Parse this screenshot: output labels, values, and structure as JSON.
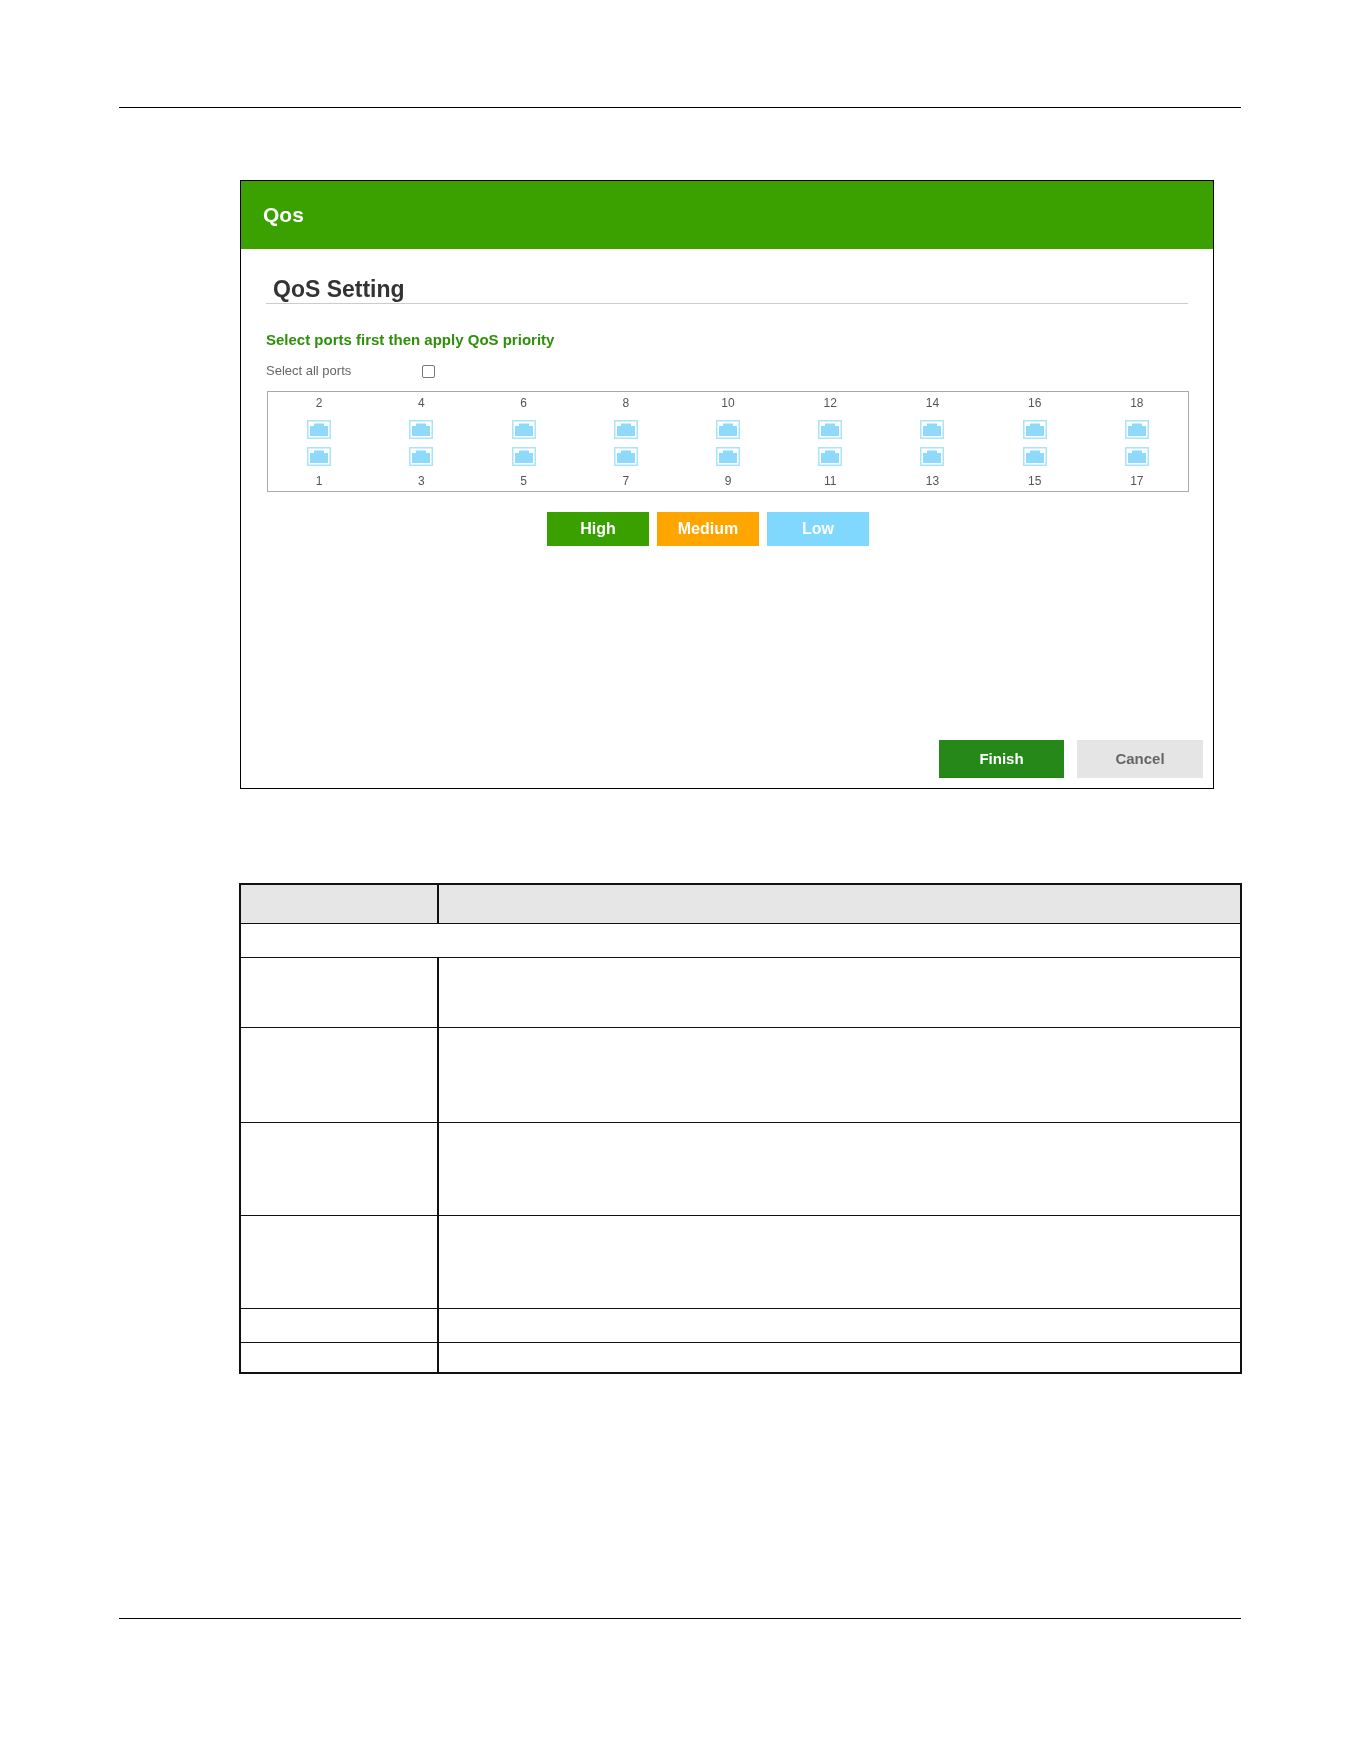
{
  "header": {
    "title": "Qos"
  },
  "section": {
    "title": "QoS Setting",
    "instruction": "Select ports first then apply QoS priority",
    "select_all": {
      "label": "Select all ports",
      "checked": false
    }
  },
  "ports": {
    "top_row": [
      {
        "label": "2",
        "selected": false
      },
      {
        "label": "4",
        "selected": false
      },
      {
        "label": "6",
        "selected": false
      },
      {
        "label": "8",
        "selected": false
      },
      {
        "label": "10",
        "selected": false
      },
      {
        "label": "12",
        "selected": false
      },
      {
        "label": "14",
        "selected": false
      },
      {
        "label": "16",
        "selected": false
      },
      {
        "label": "18",
        "selected": false
      }
    ],
    "bottom_row": [
      {
        "label": "1",
        "selected": false
      },
      {
        "label": "3",
        "selected": false
      },
      {
        "label": "5",
        "selected": false
      },
      {
        "label": "7",
        "selected": false
      },
      {
        "label": "9",
        "selected": false
      },
      {
        "label": "11",
        "selected": false
      },
      {
        "label": "13",
        "selected": false
      },
      {
        "label": "15",
        "selected": false
      },
      {
        "label": "17",
        "selected": false
      }
    ]
  },
  "priority_buttons": [
    {
      "label": "High",
      "color": "#3aa000"
    },
    {
      "label": "Medium",
      "color": "#ffa500"
    },
    {
      "label": "Low",
      "color": "#80d8ff"
    }
  ],
  "footer_buttons": [
    {
      "label": "Finish",
      "kind": "primary"
    },
    {
      "label": "Cancel",
      "kind": "secondary"
    }
  ]
}
